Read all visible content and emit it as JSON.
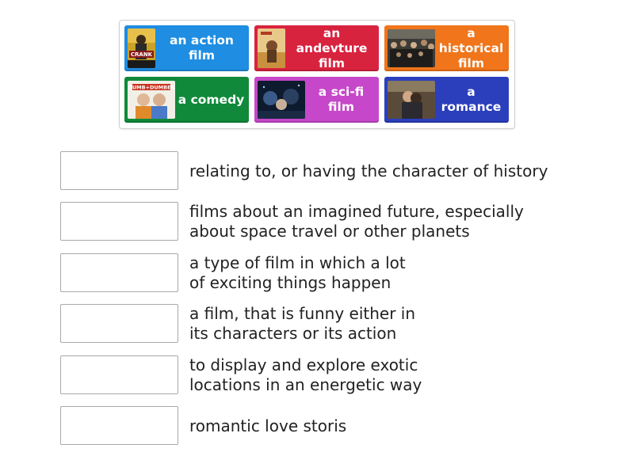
{
  "tiles": [
    {
      "id": "action",
      "label": "an action film",
      "image": "crank-poster"
    },
    {
      "id": "adventure",
      "label": "an andevture film",
      "image": "desert-adventure-poster"
    },
    {
      "id": "historical",
      "label": "a historical film",
      "image": "crowd-scene-still"
    },
    {
      "id": "comedy",
      "label": "a comedy",
      "image": "dumb-and-dumber-poster"
    },
    {
      "id": "scifi",
      "label": "a sci-fi film",
      "image": "sci-fi-still"
    },
    {
      "id": "romance",
      "label": "a romance",
      "image": "romance-still"
    }
  ],
  "poster_text": {
    "crank": "CRANK",
    "dumb": "DUMB+DUMBER"
  },
  "definitions": [
    "relating to, or having the character of history",
    "films about an imagined future, especially\nabout space travel or other planets",
    "a type of film in which a lot\nof exciting things happen",
    "a film, that is funny either in\nits characters or its action",
    "to display and explore exotic\nlocations in an energetic way",
    "romantic love storis"
  ],
  "colors": {
    "action": "#1e8de2",
    "adventure": "#d8233f",
    "historical": "#f0751b",
    "comedy": "#10893a",
    "scifi": "#c647c9",
    "romance": "#2b3fbd"
  }
}
